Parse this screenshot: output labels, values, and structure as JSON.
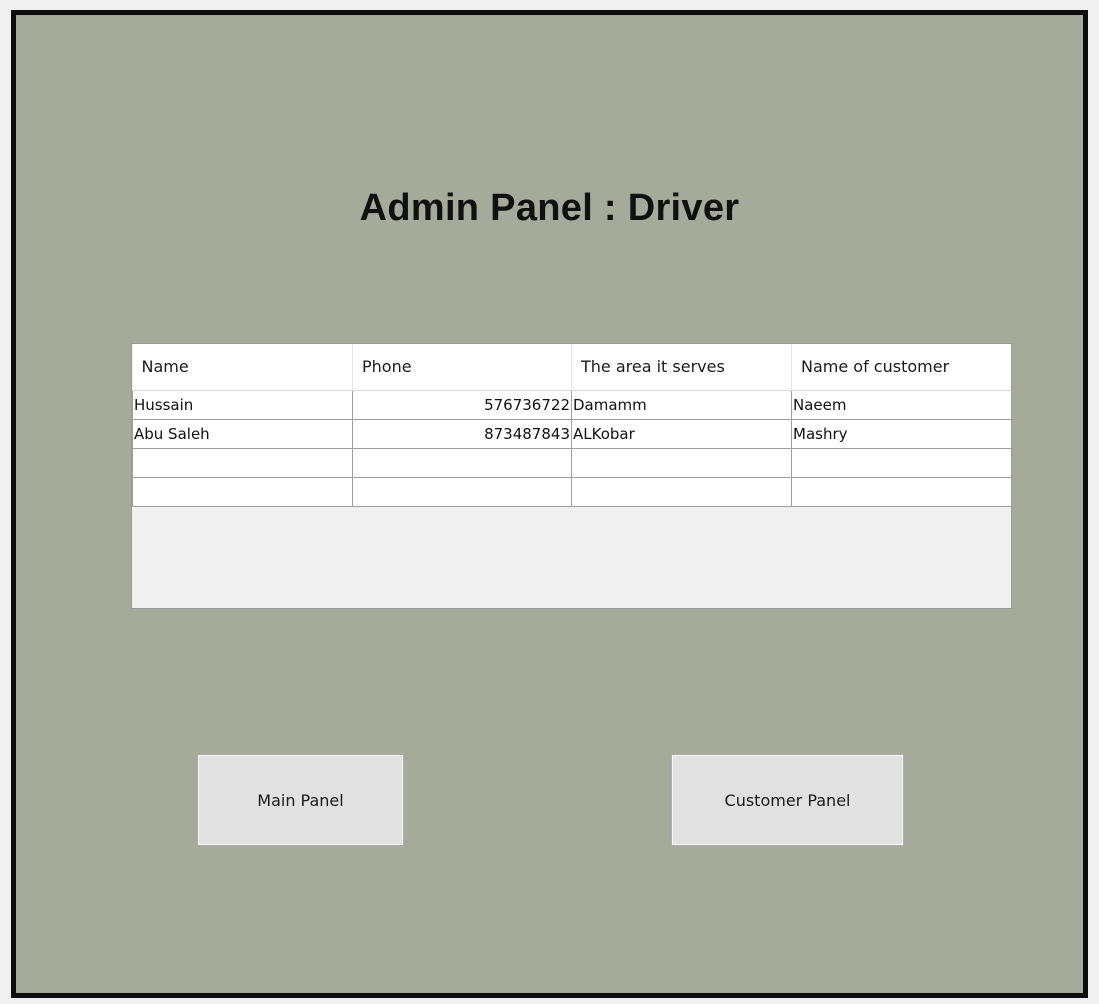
{
  "title": "Admin Panel : Driver",
  "table": {
    "headers": [
      "Name",
      "Phone",
      "The area it serves",
      "Name of customer"
    ],
    "rows": [
      [
        "Hussain",
        "576736722",
        "Damamm",
        "Naeem"
      ],
      [
        "Abu Saleh",
        "873487843",
        "ALKobar",
        "Mashry"
      ],
      [
        "",
        "",
        "",
        ""
      ],
      [
        "",
        "",
        "",
        ""
      ]
    ]
  },
  "buttons": {
    "main_panel": "Main Panel",
    "customer_panel": "Customer Panel"
  },
  "colors": {
    "form_background": "#a6aa9b",
    "frame_border": "#0d0d0d",
    "grid_background": "#f0f0f0",
    "button_face": "#e1e1e1"
  }
}
